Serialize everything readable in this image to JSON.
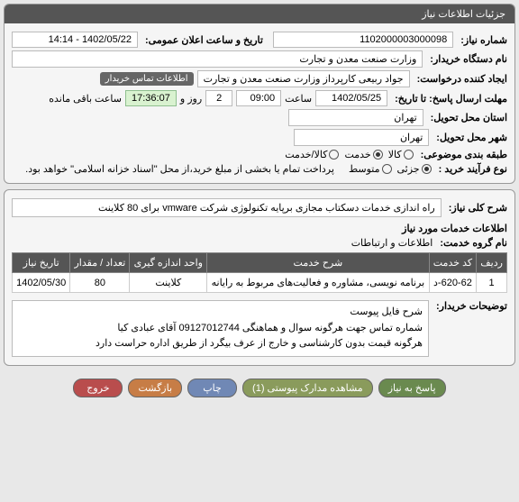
{
  "panel_title": "جزئیات اطلاعات نیاز",
  "fields": {
    "need_no_label": "شماره نیاز:",
    "need_no": "1102000003000098",
    "public_datetime_label": "تاریخ و ساعت اعلان عمومی:",
    "public_datetime": "1402/05/22 - 14:14",
    "buyer_org_label": "نام دستگاه خریدار:",
    "buyer_org": "وزارت صنعت معدن و تجارت",
    "requester_label": "ایجاد کننده درخواست:",
    "requester": "جواد ربیعی کارپرداز وزارت صنعت معدن و تجارت",
    "contact_tag": "اطلاعات تماس خریدار",
    "deadline_label": "مهلت ارسال پاسخ: تا تاریخ:",
    "deadline_date": "1402/05/25",
    "time_label": "ساعت",
    "deadline_time": "09:00",
    "days_label": "روز و",
    "days_remaining": "2",
    "countdown": "17:36:07",
    "remaining_label": "ساعت باقی مانده",
    "province_label": "استان محل تحویل:",
    "province": "تهران",
    "city_label": "شهر محل تحویل:",
    "city": "تهران",
    "subject_class_label": "طبقه بندی موضوعی:",
    "subject_opts": {
      "goods": "کالا",
      "service": "خدمت",
      "both": "کالا/خدمت"
    },
    "subject_selected": "service",
    "process_label": "نوع فرآیند خرید :",
    "process_opts": {
      "partial": "جزئی",
      "medium": "متوسط"
    },
    "process_selected": "partial",
    "process_note": "پرداخت تمام یا بخشی از مبلغ خرید،از محل \"اسناد خزانه اسلامی\" خواهد بود.",
    "main_desc_label": "شرح کلی نیاز:",
    "main_desc": "راه اندازی خدمات دسکتاب مجازی برپایه تکنولوژی شرکت vmware  برای 80 کلاینت",
    "services_header": "اطلاعات خدمات مورد نیاز",
    "services_sub": "اطلاعات و ارتباطات",
    "services_sub_prefix": "نام گروه خدمت:",
    "table": {
      "headers": [
        "ردیف",
        "کد خدمت",
        "شرح خدمت",
        "واحد اندازه گیری",
        "تعداد / مقدار",
        "تاریخ نیاز"
      ],
      "rows": [
        {
          "idx": "1",
          "code": "620-62-د",
          "desc": "برنامه نویسی، مشاوره و فعالیت‌های مربوط به رایانه",
          "unit": "کلاینت",
          "qty": "80",
          "date": "1402/05/30"
        }
      ]
    },
    "buyer_notes_label": "توضیحات خریدار:",
    "buyer_notes_line1": "شرح فایل پیوست",
    "buyer_notes_line2": "شماره تماس جهت هرگونه سوال و هماهنگی 09127012744  آقای عبادی کیا",
    "buyer_notes_line3": "هرگونه قیمت بدون کارشناسی و خارج از عرف بیگرد از طریق اداره حراست دارد"
  },
  "buttons": {
    "reply": "پاسخ به نیاز",
    "attachments": "مشاهده مدارک پیوستی (1)",
    "print": "چاپ",
    "back": "بازگشت",
    "exit": "خروج"
  }
}
